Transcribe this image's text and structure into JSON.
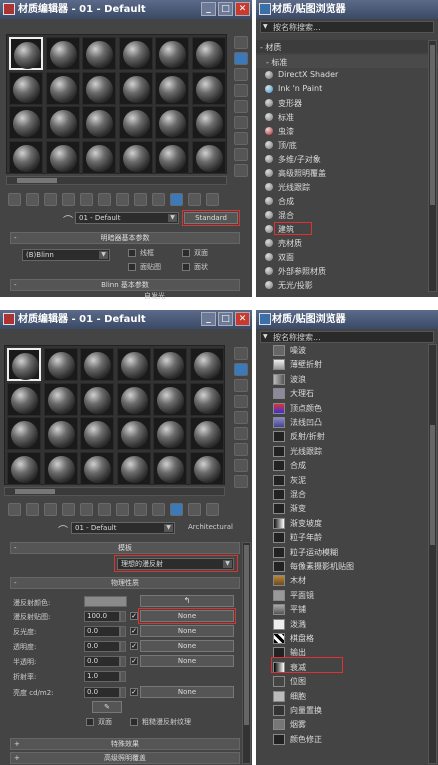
{
  "top_editor": {
    "title": "材质编辑器 - 01 - Default",
    "material_name": "01 - Default",
    "type_button": "Standard",
    "shader_rollout": "明暗器基本参数",
    "shader": "(B)Blinn",
    "wire": "线框",
    "two_sided": "双面",
    "face_map": "面贴图",
    "faceted": "面状",
    "blinn_rollout": "Blinn 基本参数",
    "self_illum": "自发光"
  },
  "top_browser": {
    "title": "材质/贴图浏览器",
    "search_placeholder": "按名称搜索...",
    "group": "- 材质",
    "subgroup": "- 标准",
    "items": [
      {
        "label": "DirectX Shader",
        "color": "#666"
      },
      {
        "label": "Ink 'n Paint",
        "color": "#3a9ad9"
      },
      {
        "label": "变形器",
        "color": "#777"
      },
      {
        "label": "标准",
        "color": "#777"
      },
      {
        "label": "虫漆",
        "color": "#c02020"
      },
      {
        "label": "顶/底",
        "color": "#777"
      },
      {
        "label": "多维/子对象",
        "color": "#777"
      },
      {
        "label": "高级照明覆盖",
        "color": "#777"
      },
      {
        "label": "光线跟踪",
        "color": "#777"
      },
      {
        "label": "合成",
        "color": "#777"
      },
      {
        "label": "混合",
        "color": "#777"
      },
      {
        "label": "建筑",
        "color": "#777"
      },
      {
        "label": "壳材质",
        "color": "#777"
      },
      {
        "label": "双面",
        "color": "#777"
      },
      {
        "label": "外部参照材质",
        "color": "#777"
      },
      {
        "label": "无光/投影",
        "color": "#777"
      }
    ]
  },
  "bottom_editor": {
    "title": "材质编辑器 - 01 - Default",
    "material_name": "01 - Default",
    "type_label": "Architectural",
    "template_rollout": "模板",
    "template_value": "理想的漫反射",
    "physical_rollout": "物理性质",
    "props": {
      "diffuse_color": "漫反射颜色:",
      "diffuse_map": "漫反射贴图:",
      "diffuse_map_value": "100.0",
      "none": "None",
      "shininess": "反光度:",
      "shininess_value": "0.0",
      "transparency": "透明度:",
      "transparency_value": "0.0",
      "translucency": "半透明:",
      "translucency_value": "0.0",
      "ior": "折射率:",
      "ior_value": "1.0",
      "luminance": "亮度 cd/m2:",
      "luminance_value": "0.0",
      "two_sided": "双面",
      "raw_diffuse": "粗糙漫反射纹理"
    },
    "special_effects": "特殊效果",
    "adv_lighting": "高级照明覆盖"
  },
  "bottom_browser": {
    "title": "材质/贴图浏览器",
    "search_placeholder": "按名称搜索...",
    "items": [
      {
        "label": "噪波"
      },
      {
        "label": "薄壁折射"
      },
      {
        "label": "波浪"
      },
      {
        "label": "大理石"
      },
      {
        "label": "顶点颜色"
      },
      {
        "label": "法线凹凸"
      },
      {
        "label": "反射/折射"
      },
      {
        "label": "光线跟踪"
      },
      {
        "label": "合成"
      },
      {
        "label": "灰泥"
      },
      {
        "label": "混合"
      },
      {
        "label": "渐变"
      },
      {
        "label": "渐变坡度"
      },
      {
        "label": "粒子年龄"
      },
      {
        "label": "粒子运动模糊"
      },
      {
        "label": "每像素摄影机贴图"
      },
      {
        "label": "木材"
      },
      {
        "label": "平面镜"
      },
      {
        "label": "平铺"
      },
      {
        "label": "泼溅"
      },
      {
        "label": "棋盘格"
      },
      {
        "label": "输出"
      },
      {
        "label": "衰减"
      },
      {
        "label": "位图"
      },
      {
        "label": "细胞"
      },
      {
        "label": "向量置换"
      },
      {
        "label": "烟雾"
      },
      {
        "label": "颜色修正"
      }
    ]
  }
}
